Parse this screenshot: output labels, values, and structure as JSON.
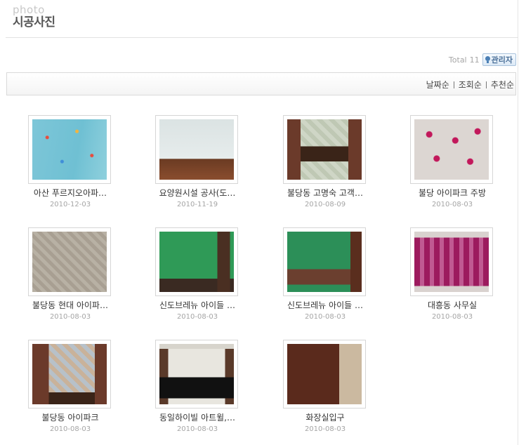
{
  "header": {
    "subtitle": "photo",
    "title": "시공사진"
  },
  "toolbar": {
    "total_label": "Total",
    "total_count": "11",
    "admin_label": "관리자"
  },
  "sort": {
    "by_date": "날짜순",
    "by_views": "조회순",
    "by_recommend": "추천순"
  },
  "gallery": [
    {
      "caption": "아산 푸르지오아파…",
      "date": "2010-12-03"
    },
    {
      "caption": "요양원시설 공사(도…",
      "date": "2010-11-19"
    },
    {
      "caption": "불당동 고명숙 고객…",
      "date": "2010-08-09"
    },
    {
      "caption": "불당 아이파크 주방",
      "date": "2010-08-03"
    },
    {
      "caption": "불당동 현대 아이파…",
      "date": "2010-08-03"
    },
    {
      "caption": "신도브레뉴 아이들 …",
      "date": "2010-08-03"
    },
    {
      "caption": "신도브레뉴 아이들 …",
      "date": "2010-08-03"
    },
    {
      "caption": "대흥동 사무실",
      "date": "2010-08-03"
    },
    {
      "caption": "불당동 아이파크",
      "date": "2010-08-03"
    },
    {
      "caption": "동일하이빌 아트윌,…",
      "date": "2010-08-03"
    },
    {
      "caption": "화장실입구",
      "date": "2010-08-03"
    }
  ]
}
